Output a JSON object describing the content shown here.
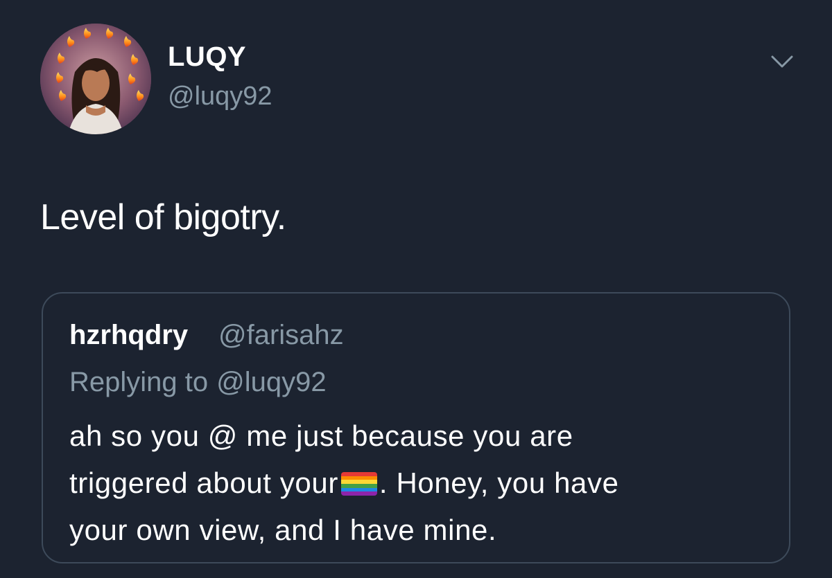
{
  "tweet": {
    "author": {
      "display_name": "LUQY",
      "handle": "@luqy92",
      "avatar": "profile-photo-with-flame-emoji-halo"
    },
    "menu_icon": "chevron-down-icon",
    "text": "Level of bigotry."
  },
  "quoted_tweet": {
    "author": {
      "display_name": "hzrhqdry",
      "handle": "@farisahz"
    },
    "replying_label": "Replying to",
    "replying_to": "@luqy92",
    "body": {
      "line1": "ah so you @ me just because you are",
      "line2_before_emoji": "triggered about your",
      "emoji": "rainbow-flag-emoji",
      "line2_after_emoji": ". Honey, you have",
      "line3": "your own view, and I have mine."
    }
  },
  "colors": {
    "background": "#1c2330",
    "primary_text": "#ffffff",
    "secondary_text": "#8899a6",
    "card_border": "#3d4a5a"
  }
}
